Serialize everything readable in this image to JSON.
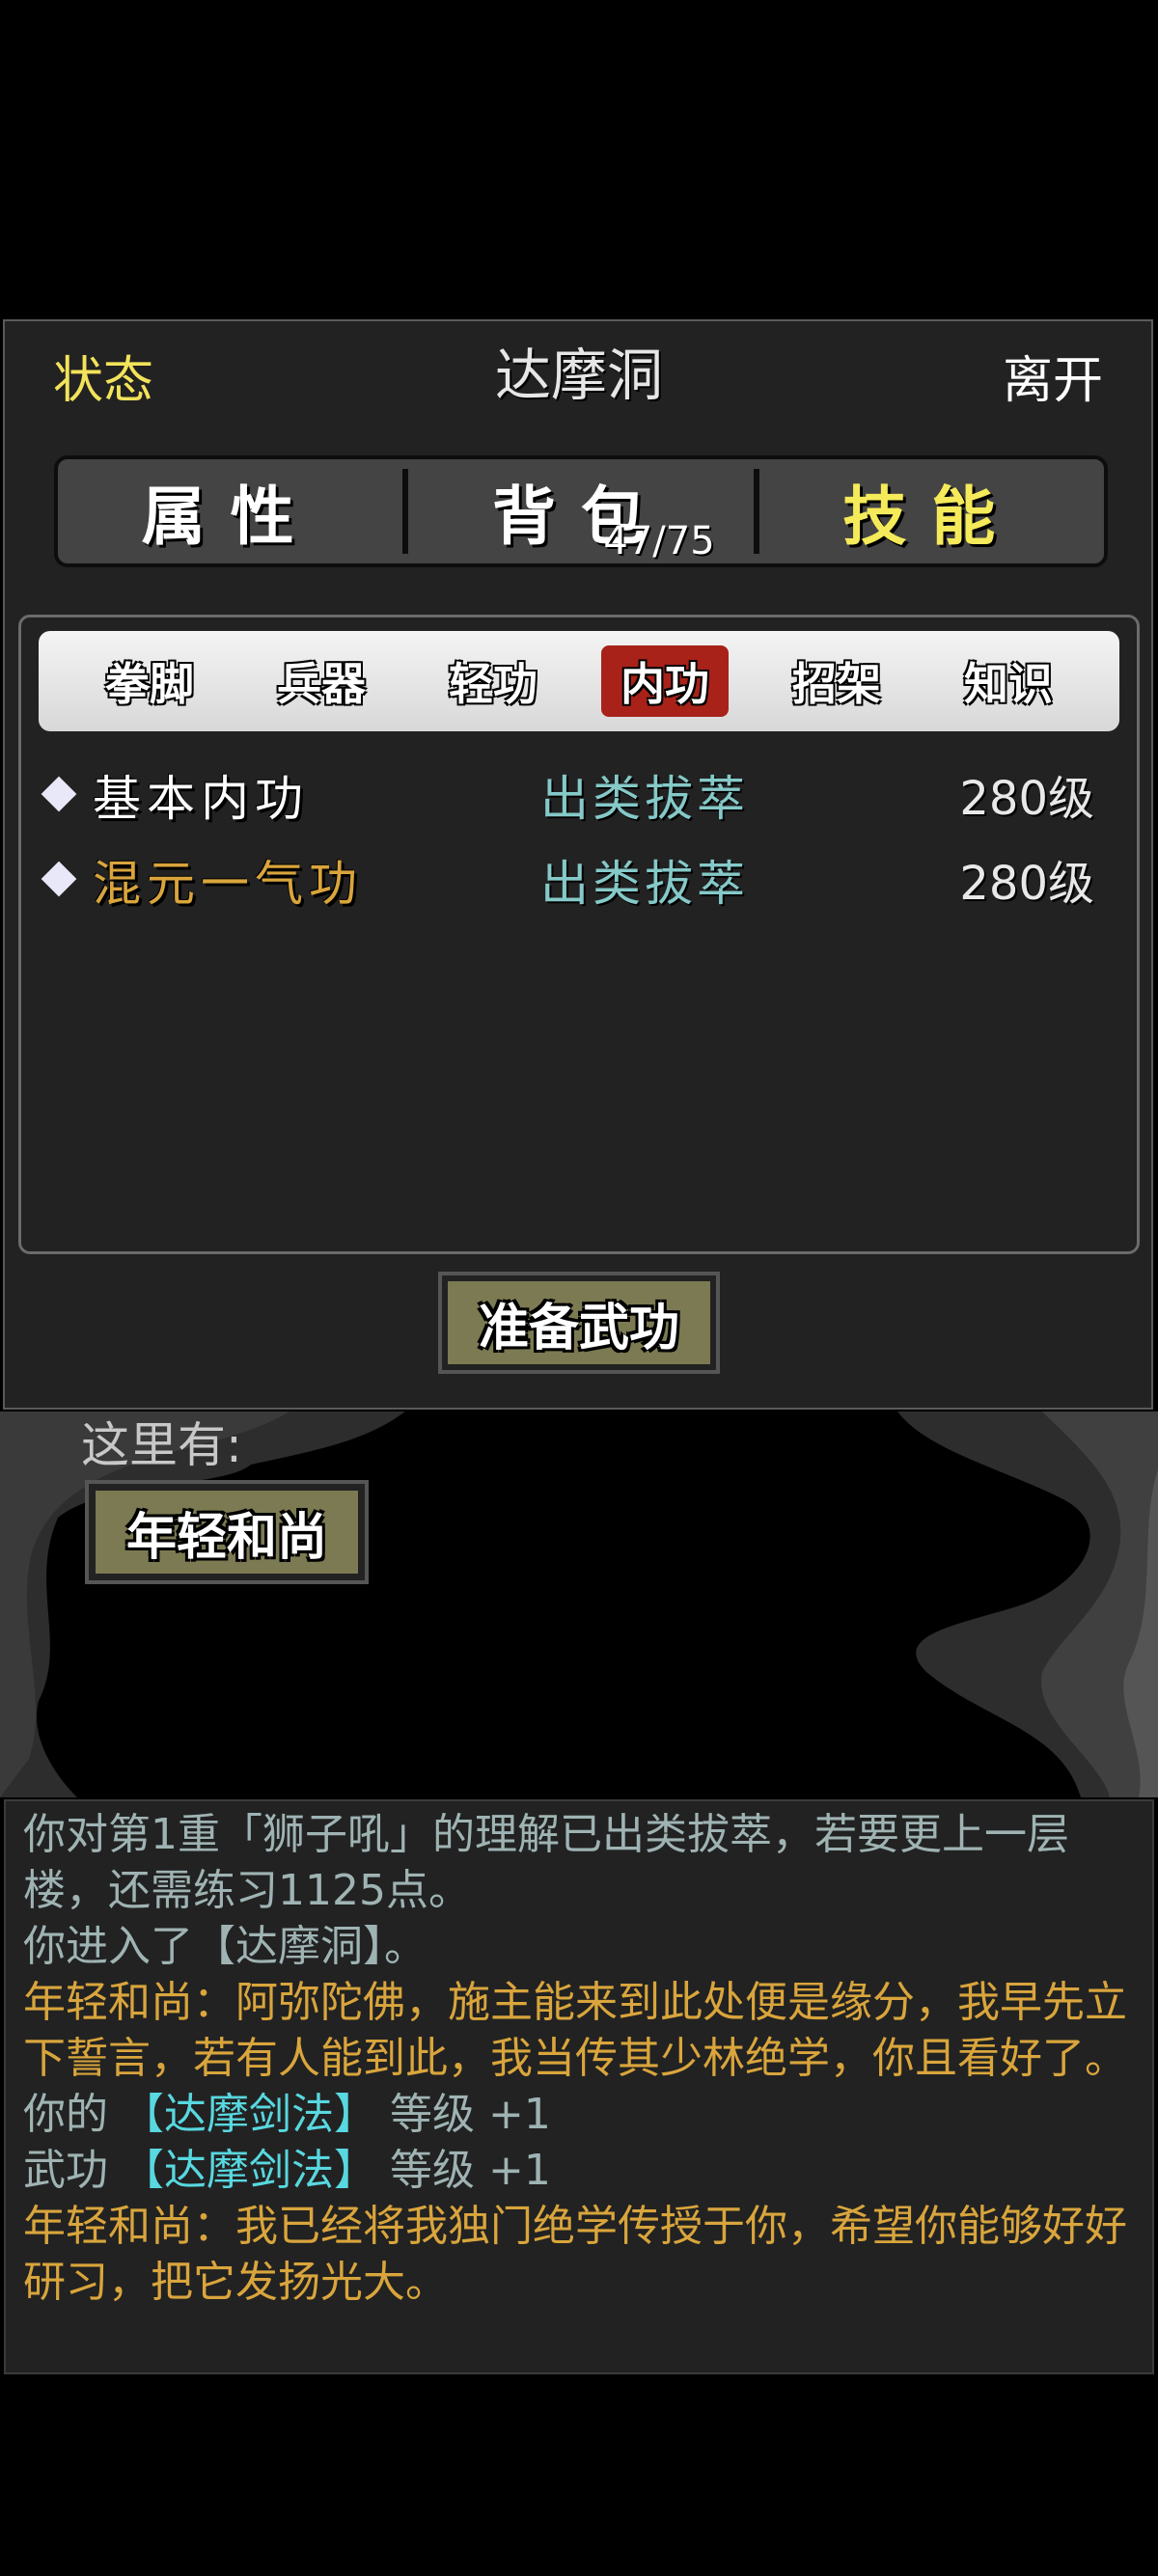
{
  "header": {
    "left": "状态",
    "title": "达摩洞",
    "right": "离开"
  },
  "tabs": [
    {
      "label": "属性",
      "active": false
    },
    {
      "label": "背包",
      "count": "47/75",
      "active": false
    },
    {
      "label": "技能",
      "active": true
    }
  ],
  "subtabs": [
    "拳脚",
    "兵器",
    "轻功",
    "内功",
    "招架",
    "知识"
  ],
  "active_subtab": "内功",
  "skills": [
    {
      "name": "基本内功",
      "level": "出类拔萃",
      "grade": "280级",
      "color": "#ffffff"
    },
    {
      "name": "混元一气功",
      "level": "出类拔萃",
      "grade": "280级",
      "color": "#d9a53c"
    }
  ],
  "prepare_button": "准备武功",
  "scene": {
    "here_label": "这里有:",
    "npcs": [
      "年轻和尚"
    ]
  },
  "log": [
    {
      "type": "sys",
      "parts": [
        {
          "t": "你对第1重「狮子吼」的理解已出类拔萃，若要更上一层楼，还需练习1125点。"
        }
      ]
    },
    {
      "type": "sys",
      "parts": [
        {
          "t": "你进入了【达摩洞】。"
        }
      ]
    },
    {
      "type": "npc",
      "parts": [
        {
          "t": "年轻和尚：阿弥陀佛，施主能来到此处便是缘分，我早先立下誓言，若有人能到此，我当传其少林绝学，你且看好了。"
        }
      ]
    },
    {
      "type": "sys",
      "parts": [
        {
          "t": "你的 "
        },
        {
          "t": "【达摩剑法】",
          "hl": true
        },
        {
          "t": " 等级 +1"
        }
      ]
    },
    {
      "type": "sys",
      "parts": [
        {
          "t": "武功 "
        },
        {
          "t": "【达摩剑法】",
          "hl": true
        },
        {
          "t": " 等级 +1"
        }
      ]
    },
    {
      "type": "npc",
      "parts": [
        {
          "t": "年轻和尚：我已经将我独门绝学传授于你，希望你能够好好研习，把它发扬光大。"
        }
      ]
    }
  ]
}
